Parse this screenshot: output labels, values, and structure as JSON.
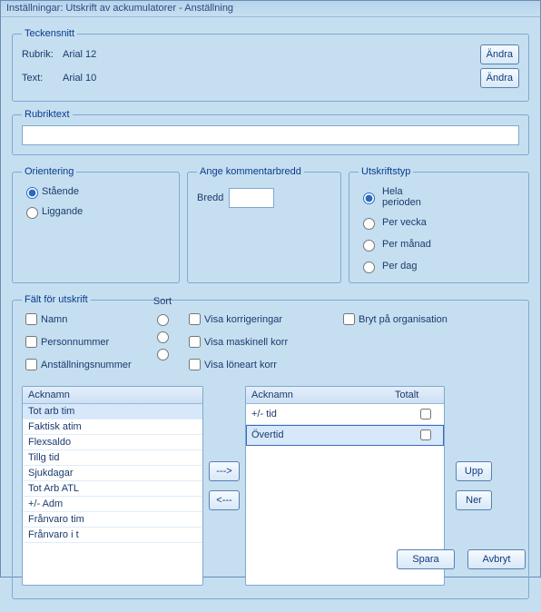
{
  "window_title": "Inställningar: Utskrift av ackumulatorer - Anställning",
  "teckensnitt": {
    "legend": "Teckensnitt",
    "rubrik_label": "Rubrik:",
    "rubrik_value": "Arial 12",
    "text_label": "Text:",
    "text_value": "Arial 10",
    "change_btn": "Ändra"
  },
  "rubriktext": {
    "legend": "Rubriktext",
    "value": ""
  },
  "orientering": {
    "legend": "Orientering",
    "options": [
      "Stående",
      "Liggande"
    ],
    "selected": 0
  },
  "kommentarbredd": {
    "legend": "Ange kommentarbredd",
    "label": "Bredd",
    "value": ""
  },
  "utskriftstyp": {
    "legend": "Utskriftstyp",
    "options": [
      "Hela perioden",
      "Per vecka",
      "Per månad",
      "Per dag"
    ],
    "selected": 0
  },
  "falt": {
    "legend": "Fält för utskrift",
    "sort_label": "Sort",
    "left_checks": [
      "Namn",
      "Personnummer",
      "Anställningsnummer"
    ],
    "mid_checks": [
      "Visa korrigeringar",
      "Visa maskinell korr",
      "Visa löneart korr"
    ],
    "right_check": "Bryt på organisation"
  },
  "left_list": {
    "header": "Acknamn",
    "items": [
      "Tot arb tim",
      "Faktisk atim",
      "Flexsaldo",
      "Tillg tid",
      "Sjukdagar",
      "Tot Arb ATL",
      "+/- Adm",
      "Frånvaro tim",
      "Frånvaro i t"
    ]
  },
  "right_list": {
    "header_ack": "Acknamn",
    "header_tot": "Totalt",
    "rows": [
      {
        "ack": "+/- tid",
        "tot": false
      },
      {
        "ack": "Övertid",
        "tot": false
      }
    ]
  },
  "buttons": {
    "move_right": "--->",
    "move_left": "<---",
    "up": "Upp",
    "down": "Ner",
    "save": "Spara",
    "cancel": "Avbryt"
  }
}
